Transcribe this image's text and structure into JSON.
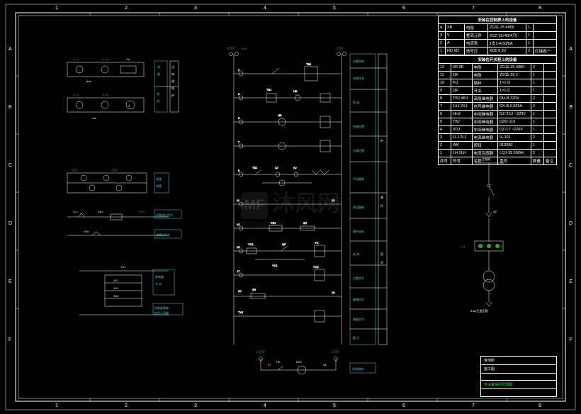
{
  "grid_marks": {
    "rows": [
      "A",
      "B",
      "C",
      "D",
      "E",
      "F"
    ],
    "cols": [
      "1",
      "2",
      "3",
      "4",
      "5",
      "6",
      "7",
      "8"
    ]
  },
  "watermark": {
    "logo": "MF",
    "text": "沐风网",
    "url": "mfcad.com"
  },
  "title_block": {
    "org": "变电所",
    "stage": "施工图",
    "drawing": "专设备保护原理图",
    "area": "",
    "sheet": ""
  },
  "bom": {
    "upper_header": "安装在控制屏上的设备",
    "upper": [
      {
        "n": "4",
        "sym": "XB",
        "name": "电阻",
        "model": "ZG11-25 4000",
        "qty": "1",
        "note": ""
      },
      {
        "n": "3",
        "sym": "V",
        "name": "整流元件",
        "model": "2CZ-11×40(4只)",
        "qty": "1",
        "note": ""
      },
      {
        "n": "2",
        "sym": "A",
        "name": "电流表",
        "model": "1支1-A 50/5A",
        "qty": "1",
        "note": ""
      },
      {
        "n": "1",
        "sym": "HD XD",
        "name": "信号灯",
        "model": "XD5 6.3V",
        "qty": "2",
        "note": "红绿各一"
      }
    ],
    "lower_header": "安装在开关柜上的设备",
    "lower": [
      {
        "n": "12",
        "sym": "2R 3R",
        "name": "电阻",
        "model": "ZG11-25 4000",
        "qty": "2",
        "note": ""
      },
      {
        "n": "11",
        "sym": "1R",
        "name": "电阻",
        "model": "ZG11-25 1",
        "qty": "1",
        "note": ""
      },
      {
        "n": "10",
        "sym": "FU",
        "name": "熔丝",
        "model": "1×1-D",
        "qty": "1",
        "note": ""
      },
      {
        "n": "9",
        "sym": "QF",
        "name": "开关",
        "model": "1×1-C",
        "qty": "1",
        "note": ""
      },
      {
        "n": "8",
        "sym": "TBJ XBJ",
        "name": "高阻继电器",
        "model": "DH-B 220V",
        "qty": "2",
        "note": ""
      },
      {
        "n": "7",
        "sym": "1XJ 2XJ",
        "name": "信号继电器",
        "model": "DX-B 0.025A",
        "qty": "2",
        "note": ""
      },
      {
        "n": "6",
        "sym": "HHJ",
        "name": "中间继电器",
        "model": "DZ-21U ~220V",
        "qty": "1",
        "note": ""
      },
      {
        "n": "5",
        "sym": "TBJ",
        "name": "中间继电器",
        "model": "DZO-115",
        "qty": "1",
        "note": ""
      },
      {
        "n": "4",
        "sym": "XDJ",
        "name": "中间继电器",
        "model": "DZ-17 ~220V",
        "qty": "1",
        "note": ""
      },
      {
        "n": "3",
        "sym": "1LJ 2LJ",
        "name": "电流继电器",
        "model": "IL-101",
        "qty": "2",
        "note": ""
      },
      {
        "n": "2",
        "sym": "WK",
        "name": "按钮",
        "model": "0192B1",
        "qty": "1",
        "note": ""
      },
      {
        "n": "1",
        "sym": "LH 2LH",
        "name": "电流互感器",
        "model": "LQJ-35 50/5A",
        "qty": "2",
        "note": ""
      }
    ],
    "cols": [
      "序号",
      "符号",
      "名称",
      "型号",
      "数量",
      "备注"
    ]
  },
  "single_line": {
    "top": "主电网",
    "switch": "QF",
    "ct": "LH 2LH",
    "xformer": "B-6#主变压器"
  },
  "blocks": {
    "a1": {
      "labels": [
        "2LJx",
        "2LJg",
        "1xJ",
        "过",
        "电",
        "流",
        "保",
        "护"
      ],
      "rows": [
        "1LJx",
        "1LJg",
        "bus"
      ]
    },
    "a2": {
      "labels": [
        "测量",
        "电流",
        "电",
        "流",
        "指",
        "示"
      ]
    },
    "b1": {
      "labels": [
        "2TJ",
        "2Jg",
        "2xJ"
      ]
    },
    "b2": {
      "in": "A8",
      "out": "A11"
    },
    "c1": {
      "labels": [
        "MS",
        "DW",
        "测温",
        "装置"
      ]
    },
    "c2": {
      "labels": [
        "XDJ",
        "HHJ",
        "设备变位信号",
        "HHJ",
        "故障总信号"
      ]
    },
    "d1": {
      "labels": [
        "TXJ",
        "继电器节点",
        "2XJ",
        "1XJ",
        "XDJ",
        "控制屏事故",
        "信号小母线"
      ]
    },
    "center": {
      "bus_left": "+1DM",
      "bus_right": "-1DM",
      "alt": "+KM",
      "rows": [
        {
          "l": "1",
          "r": "TBJ",
          "lab": "交换机构",
          "lab2": "合闸开关"
        },
        {
          "l": "3",
          "r": "TBJ",
          "lab": "防 误"
        },
        {
          "l": "5",
          "r": "HK",
          "lab": "合闸位置"
        },
        {
          "l": "7",
          "r": "HK",
          "lab": "分闸位置"
        },
        {
          "l": "9",
          "r": "TBJ",
          "lab": "手动跳闸",
          "lab2": "过电保护",
          "opts": [
            "TBJ",
            "XJ",
            "XJ"
          ]
        },
        {
          "l": "11",
          "r": "12",
          "lab": "高用跳闸"
        },
        {
          "l": "13",
          "r": "TBJ 3R",
          "lab": "保护自投"
        },
        {
          "l": "15",
          "r": "YC1 QF",
          "lab": "合 闸",
          "sub": "YC1"
        },
        {
          "l": "17",
          "r": "YC2",
          "lab": "位置信号"
        },
        {
          "l": "XJ 2R",
          "r": "18",
          "lab": "故障信号"
        },
        {
          "l": "TXJ",
          "r": "",
          "lab": "事故信号"
        },
        {
          "l": "",
          "r": "",
          "lab": "备 注"
        }
      ],
      "side": [
        "护",
        "操",
        "作",
        "信",
        "号"
      ]
    },
    "bottom": {
      "bus": [
        "+1DM",
        "-1DM"
      ],
      "els": [
        "HK",
        "HXC",
        "合闸机构"
      ],
      "nums": [
        "47",
        "43"
      ]
    }
  }
}
